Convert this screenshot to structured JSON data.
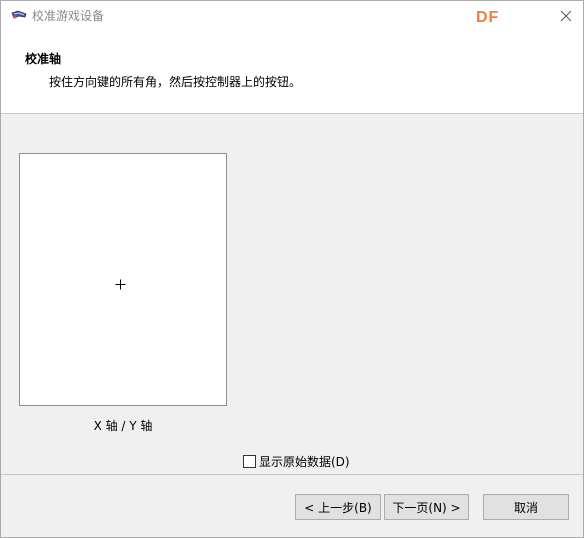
{
  "window": {
    "title": "校准游戏设备",
    "badge": "DF"
  },
  "header": {
    "title": "校准轴",
    "instruction": "按住方向键的所有角，然后按控制器上的按钮。"
  },
  "calibration": {
    "axis_label": "X 轴 / Y 轴"
  },
  "options": {
    "raw_data_label": "显示原始数据(D)",
    "raw_data_checked": false
  },
  "buttons": {
    "back_label": "< 上一步(B)",
    "next_label": "下一页(N) >",
    "cancel_label": "取消"
  },
  "icons": {
    "app": "game-controller-icon",
    "close": "close-icon",
    "crosshair": "crosshair-icon"
  },
  "colors": {
    "badge": "#f07f3c",
    "dialog_bg": "#f0f0f0",
    "header_bg": "#ffffff",
    "button_bg": "#e1e1e1"
  }
}
